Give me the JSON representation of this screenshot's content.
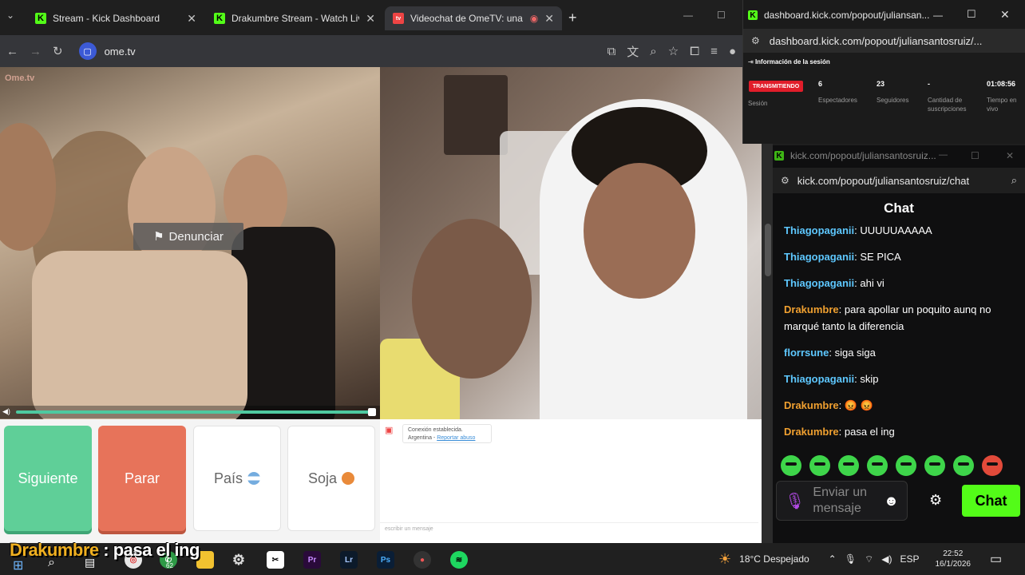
{
  "tabs": [
    {
      "title": "Stream - Kick Dashboard",
      "favicon": "K"
    },
    {
      "title": "Drakumbre Stream - Watch Live",
      "favicon": "K"
    },
    {
      "title": "Videochat de OmeTV: una a",
      "favicon": "tv"
    }
  ],
  "toolbar": {
    "url": "ome.tv"
  },
  "ome": {
    "logo": "Ome.tv",
    "report_label": "Denunciar",
    "buttons": {
      "next": "Siguiente",
      "stop": "Parar",
      "country": "País",
      "gender": "Soja"
    },
    "system_message": {
      "line1": "Conexión establecida.",
      "line2_prefix": "Argentina - ",
      "line2_link": "Reportar abuso"
    },
    "input_placeholder": "escribir un mensaje"
  },
  "dashboard": {
    "url": "dashboard.kick.com/popout/juliansan...",
    "url_full": "dashboard.kick.com/popout/juliansantosruiz/...",
    "section": "Información de la sesión",
    "live_badge": "TRANSMITIENDO",
    "stats": [
      {
        "value": "",
        "label": "Sesión"
      },
      {
        "value": "6",
        "label": "Espectadores"
      },
      {
        "value": "23",
        "label": "Seguidores"
      },
      {
        "value": "-",
        "label": "Cantidad de suscripciones"
      },
      {
        "value": "01:08:56",
        "label": "Tiempo en vivo"
      }
    ]
  },
  "chat": {
    "window_url": "kick.com/popout/juliansantosruiz...",
    "url": "kick.com/popout/juliansantosruiz/chat",
    "title": "Chat",
    "messages": [
      {
        "user": "Thiagopaganii",
        "text": "UUUUUAAAAA",
        "color": "#5ec8ff"
      },
      {
        "user": "Thiagopaganii",
        "text": "SE PICA",
        "color": "#5ec8ff"
      },
      {
        "user": "Thiagopaganii",
        "text": "ahi vi",
        "color": "#5ec8ff"
      },
      {
        "user": "Drakumbre",
        "text": "para apollar un poquito aunq no marqué tanto la diferencia",
        "color": "#f0a030"
      },
      {
        "user": "florrsune",
        "text": "siga siga",
        "color": "#5ec8ff"
      },
      {
        "user": "Thiagopaganii",
        "text": "skip",
        "color": "#5ec8ff"
      },
      {
        "user": "Drakumbre",
        "text": "😡 😡",
        "color": "#f0a030"
      },
      {
        "user": "Drakumbre",
        "text": "pasa el ing",
        "color": "#f0a030"
      }
    ],
    "input_placeholder": "Enviar un mensaje",
    "send_label": "Chat"
  },
  "overlay": {
    "user": "Drakumbre",
    "text": " : pasa el ing"
  },
  "taskbar": {
    "weather": "18°C  Despejado",
    "lang": "ESP",
    "time": "22:52",
    "date": "16/1/2026",
    "badge": "62"
  },
  "colors": {
    "kick_green": "#53fc18",
    "ome_next": "#5fcf98",
    "ome_stop": "#e7735a"
  }
}
